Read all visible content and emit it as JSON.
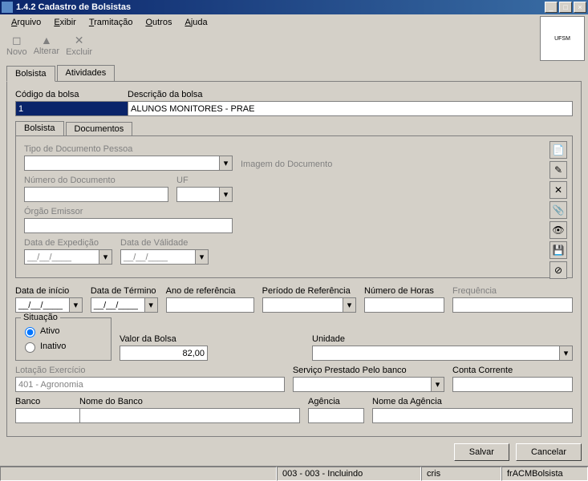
{
  "window": {
    "title": "1.4.2 Cadastro de Bolsistas"
  },
  "menu": [
    "Arquivo",
    "Exibir",
    "Tramitação",
    "Outros",
    "Ajuda"
  ],
  "toolbar": {
    "novo": "Novo",
    "alterar": "Alterar",
    "excluir": "Excluir"
  },
  "tabs": {
    "bolsista": "Bolsista",
    "atividades": "Atividades"
  },
  "header": {
    "codigo_label": "Código da bolsa",
    "codigo_value": "1",
    "descricao_label": "Descrição da bolsa",
    "descricao_value": "ALUNOS MONITORES - PRAE"
  },
  "subtabs": {
    "bolsista": "Bolsista",
    "documentos": "Documentos"
  },
  "doc": {
    "tipo_label": "Tipo de Documento Pessoa",
    "imagem_label": "Imagem do Documento",
    "numero_label": "Número do Documento",
    "uf_label": "UF",
    "orgao_label": "Órgão Emissor",
    "data_exp_label": "Data de Expedição",
    "data_val_label": "Data de Válidade",
    "date_mask": "__/__/____"
  },
  "fields": {
    "data_inicio": "Data de início",
    "data_termino": "Data de Término",
    "ano_ref": "Ano de referência",
    "periodo_ref": "Período de Referência",
    "num_horas": "Número de Horas",
    "frequencia": "Frequência",
    "situacao": "Situação",
    "ativo": "Ativo",
    "inativo": "Inativo",
    "valor_bolsa_label": "Valor da Bolsa",
    "valor_bolsa_value": "82,00",
    "unidade": "Unidade",
    "lotacao_label": "Lotação Exercício",
    "lotacao_value": "401 - Agronomia",
    "servico_banco": "Serviço Prestado Pelo banco",
    "conta_corrente": "Conta Corrente",
    "banco": "Banco",
    "nome_banco": "Nome do Banco",
    "agencia": "Agência",
    "nome_agencia": "Nome da Agência",
    "date_mask": "__/__/____"
  },
  "buttons": {
    "salvar": "Salvar",
    "cancelar": "Cancelar"
  },
  "status": {
    "center": "003 - 003 - Incluindo",
    "user": "cris",
    "form": "frACMBolsista"
  }
}
